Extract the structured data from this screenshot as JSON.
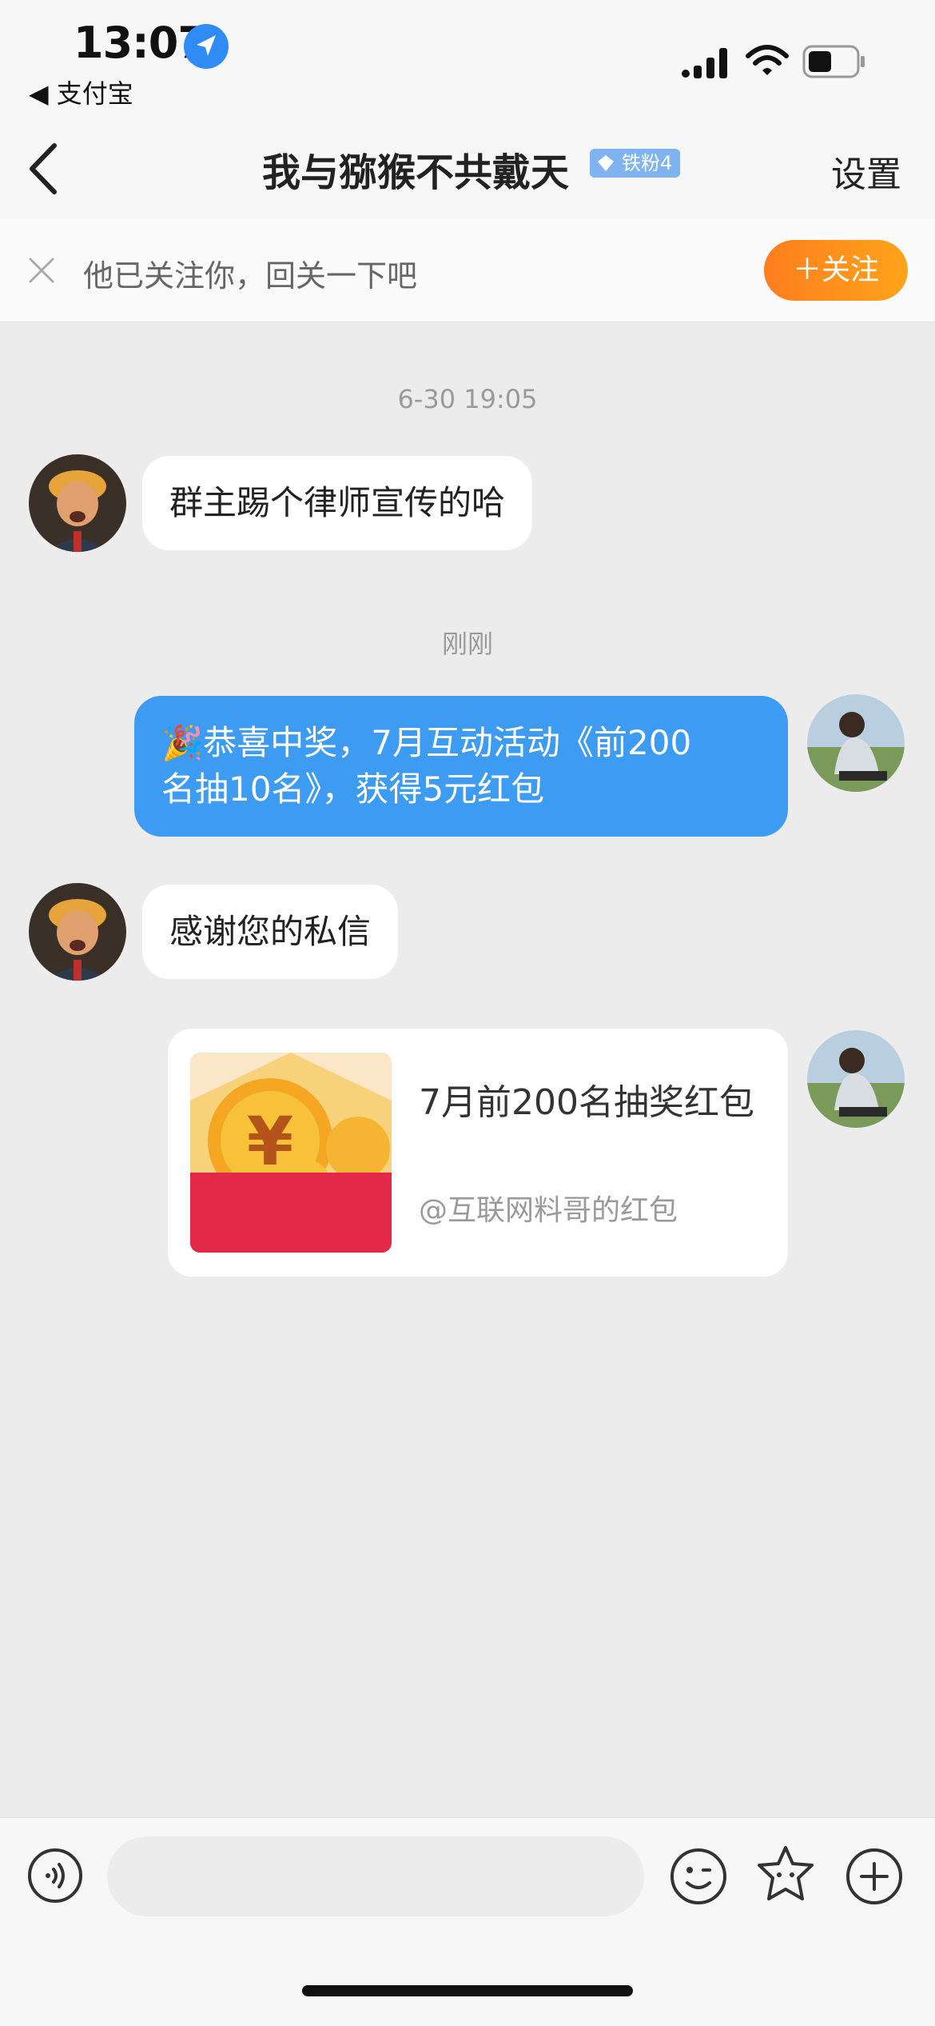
{
  "status_bar": {
    "time": "13:07",
    "back_app": "◀ 支付宝"
  },
  "nav": {
    "title": "我与猕猴不共戴天",
    "fan_badge": "铁粉4",
    "settings": "设置"
  },
  "follow_bar": {
    "text": "他已关注你，回关一下吧",
    "button": "＋关注"
  },
  "chat": {
    "timestamp1": "6-30 19:05",
    "msg1": "群主踢个律师宣传的哈",
    "timestamp2": "刚刚",
    "msg2_line1": "🎉恭喜中奖，7月互动活动《前200",
    "msg2_line2": "名抽10名》，获得5元红包",
    "msg3": "感谢您的私信",
    "red_packet": {
      "title": "7月前200名抽奖红包",
      "subtitle": "@互联网料哥的红包"
    }
  },
  "icons": {
    "voice": "voice-icon",
    "emoji": "emoji-icon",
    "sticker": "star-sticker-icon",
    "plus": "plus-icon"
  },
  "colors": {
    "accent_blue": "#3d9cf2",
    "follow_orange": "#ff8c1a",
    "red_packet": "#e4284a"
  }
}
